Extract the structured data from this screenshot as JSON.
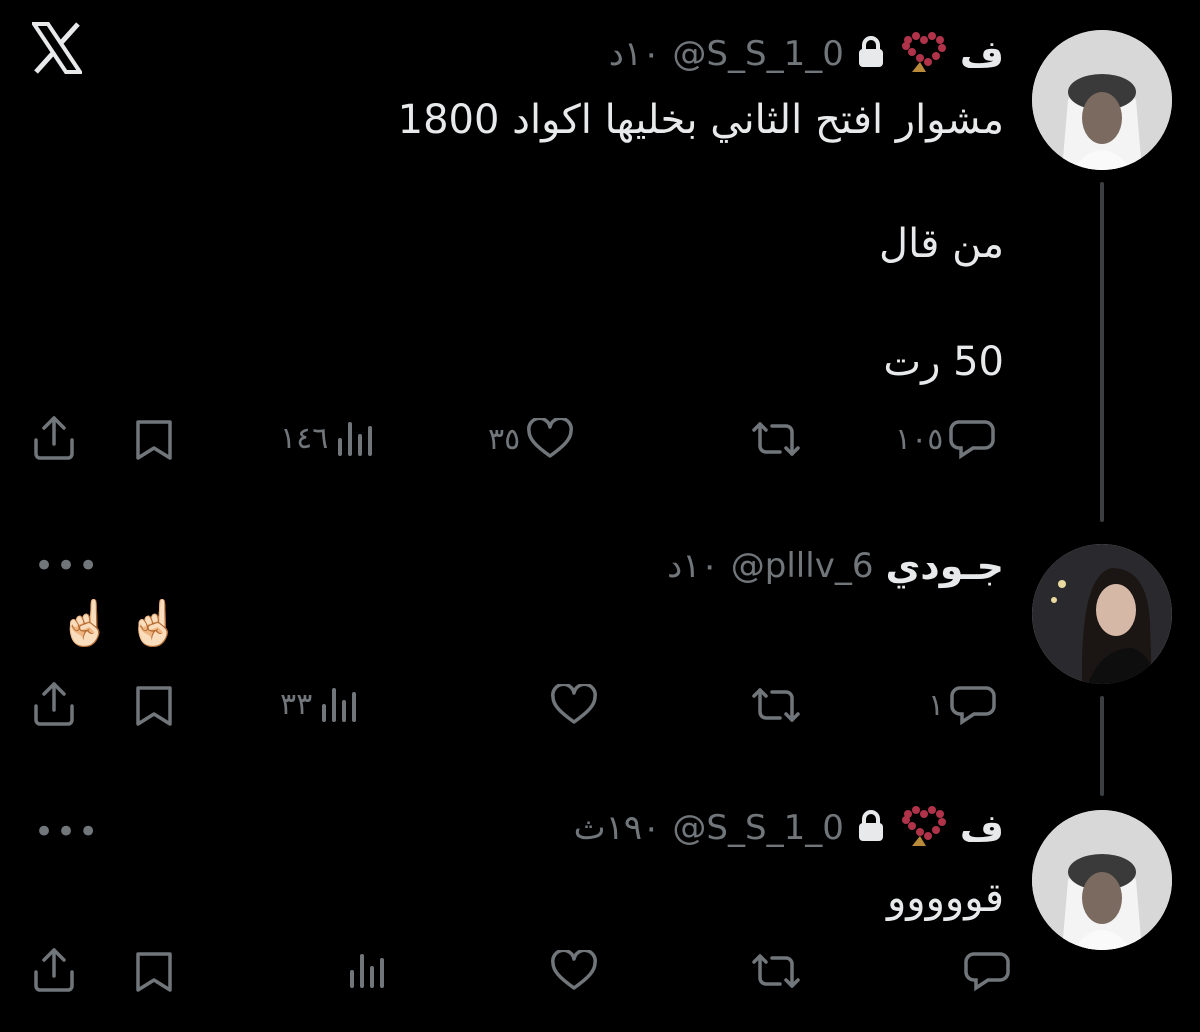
{
  "app": {
    "logo_icon": "x-logo-icon"
  },
  "colors": {
    "background": "#000000",
    "text": "#e7e9ea",
    "muted": "#71767b",
    "thread_line": "#3b3f42"
  },
  "posts": [
    {
      "name": "ف",
      "name_icons": [
        "prayer-beads-heart-icon",
        "lock-icon"
      ],
      "handle": "@S_S_1_0",
      "time": "١٠د",
      "lines": [
        "مشوار افتح الثاني بخليها اكواد 1800",
        "من قال",
        "50 رت"
      ],
      "reply_count": "١٠٥",
      "repost_count": "",
      "like_count": "٣٥",
      "view_count": "١٤٦"
    },
    {
      "name": "جـودي",
      "handle": "@plllv_6",
      "time": "١٠د",
      "more": "•••",
      "lines": [
        "☝🏻 ☝🏻"
      ],
      "reply_count": "١",
      "repost_count": "",
      "like_count": "",
      "view_count": "٣٣"
    },
    {
      "name": "ف",
      "name_icons": [
        "prayer-beads-heart-icon",
        "lock-icon"
      ],
      "handle": "@S_S_1_0",
      "time": "١٩٠ث",
      "more": "•••",
      "lines": [
        "قووووو"
      ],
      "reply_count": "",
      "repost_count": "",
      "like_count": "",
      "view_count": ""
    }
  ]
}
